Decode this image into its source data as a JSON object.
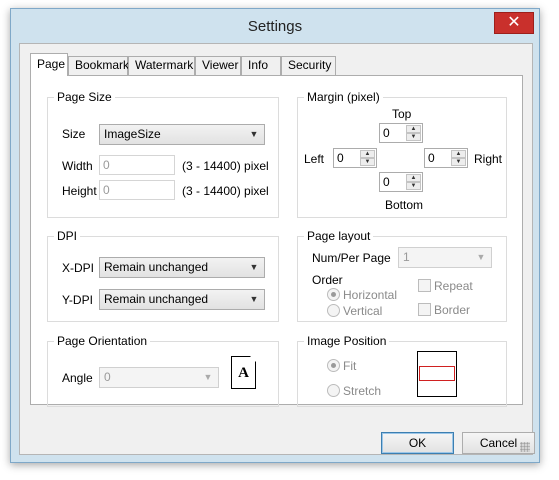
{
  "window": {
    "title": "Settings",
    "close_glyph": "✕"
  },
  "tabs": [
    "Page",
    "Bookmark",
    "Watermark",
    "Viewer",
    "Info",
    "Security"
  ],
  "page_size": {
    "title": "Page Size",
    "size_label": "Size",
    "size_value": "ImageSize",
    "width_label": "Width",
    "width_value": "0",
    "width_range": "(3 - 14400) pixel",
    "height_label": "Height",
    "height_value": "0",
    "height_range": "(3 - 14400) pixel"
  },
  "dpi": {
    "title": "DPI",
    "xdpi_label": "X-DPI",
    "xdpi_value": "Remain unchanged",
    "ydpi_label": "Y-DPI",
    "ydpi_value": "Remain unchanged"
  },
  "orientation": {
    "title": "Page Orientation",
    "angle_label": "Angle",
    "angle_value": "0",
    "page_icon": "page-portrait-icon",
    "page_icon_glyph": "A"
  },
  "margin": {
    "title": "Margin (pixel)",
    "top_label": "Top",
    "top_value": "0",
    "left_label": "Left",
    "left_value": "0",
    "right_label": "Right",
    "right_value": "0",
    "bottom_label": "Bottom",
    "bottom_value": "0"
  },
  "page_layout": {
    "title": "Page layout",
    "num_label": "Num/Per Page",
    "num_value": "1",
    "order_label": "Order",
    "horizontal_label": "Horizontal",
    "vertical_label": "Vertical",
    "repeat_label": "Repeat",
    "border_label": "Border"
  },
  "image_position": {
    "title": "Image Position",
    "fit_label": "Fit",
    "stretch_label": "Stretch"
  },
  "buttons": {
    "ok": "OK",
    "cancel": "Cancel"
  },
  "colors": {
    "accent_border": "#3c7fb1",
    "close_red": "#c9302c",
    "preview_red": "#d02020"
  }
}
